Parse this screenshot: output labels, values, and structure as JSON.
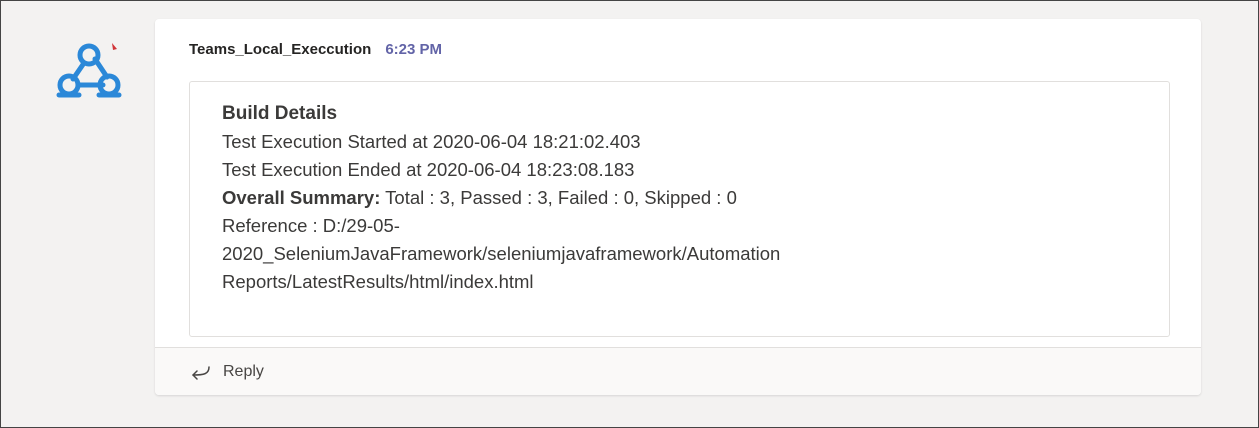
{
  "message": {
    "sender": "Teams_Local_Execcution",
    "time": "6:23 PM",
    "avatar_icon": "webhook-icon",
    "brand_color": "#2b88d8",
    "time_color": "#6264a7"
  },
  "card": {
    "title": "Build Details",
    "started": "Test Execution Started at 2020-06-04 18:21:02.403",
    "ended": "Test Execution Ended at 2020-06-04 18:23:08.183",
    "summary_label": "Overall Summary:",
    "summary_value": "Total : 3, Passed : 3, Failed : 0, Skipped : 0",
    "reference_lines": [
      "Reference : D:/29-05-",
      "2020_SeleniumJavaFramework/seleniumjavaframework/Automation",
      "Reports/LatestResults/html/index.html"
    ]
  },
  "reply": {
    "label": "Reply",
    "icon": "reply-arrow-icon"
  }
}
